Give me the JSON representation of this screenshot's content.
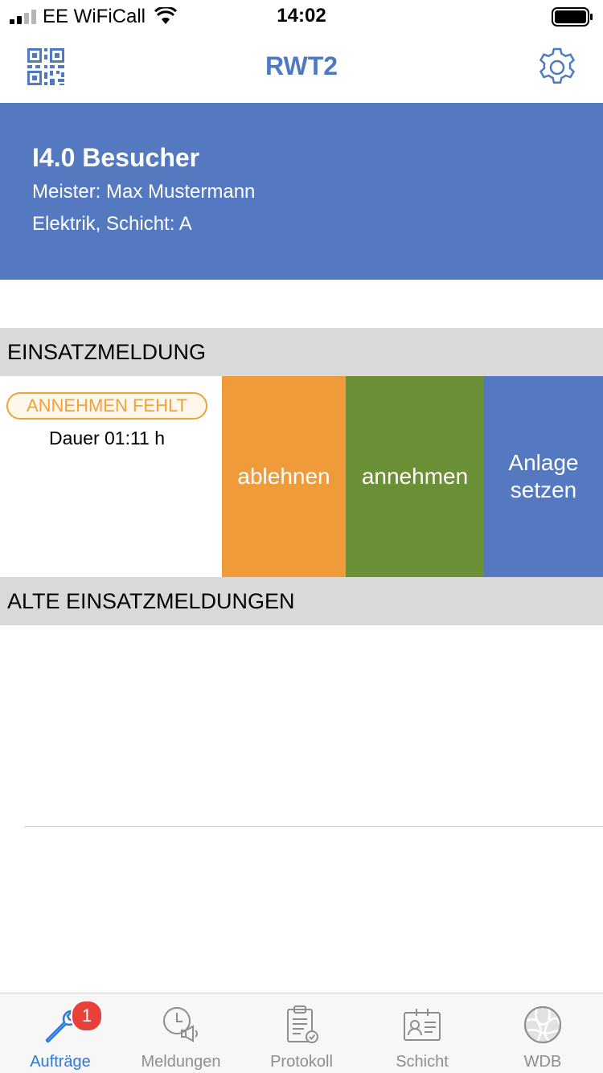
{
  "status_bar": {
    "carrier": "EE WiFiCall",
    "time": "14:02"
  },
  "nav": {
    "title": "RWT2",
    "left_icon": "qr-code-icon",
    "right_icon": "gear-icon",
    "accent_color": "#4f79c1"
  },
  "user": {
    "name": "I4.0 Besucher",
    "meister": "Meister: Max Mustermann",
    "department": "Elektrik, Schicht: A",
    "background_color": "#5479c0"
  },
  "sections": {
    "current": "EINSATZMELDUNG",
    "old": "ALTE EINSATZMELDUNGEN"
  },
  "task": {
    "status": "ANNEHMEN FEHLT",
    "duration": "Dauer 01:11 h",
    "actions": {
      "reject": "ablehnen",
      "accept": "annehmen",
      "set_plant_line1": "Anlage",
      "set_plant_line2": "setzen"
    },
    "colors": {
      "reject": "#ef9b3a",
      "accept": "#6b9036",
      "set_plant": "#5479c0",
      "status": "#f0a23a"
    }
  },
  "tabs": [
    {
      "label": "Aufträge",
      "icon": "wrench-icon",
      "badge": "1",
      "active": true
    },
    {
      "label": "Meldungen",
      "icon": "clock-megaphone-icon",
      "active": false
    },
    {
      "label": "Protokoll",
      "icon": "clipboard-icon",
      "active": false
    },
    {
      "label": "Schicht",
      "icon": "id-badge-icon",
      "active": false
    },
    {
      "label": "WDB",
      "icon": "puzzle-globe-icon",
      "active": false
    }
  ]
}
